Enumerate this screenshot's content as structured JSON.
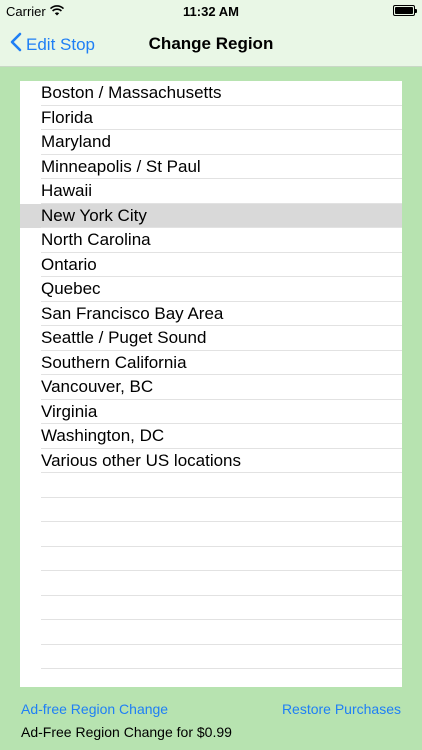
{
  "status_bar": {
    "carrier": "Carrier",
    "time": "11:32 AM"
  },
  "nav": {
    "back_label": "Edit Stop",
    "title": "Change Region"
  },
  "regions": [
    "Boston / Massachusetts",
    "Florida",
    "Maryland",
    "Minneapolis / St Paul",
    "Hawaii",
    "New York City",
    "North Carolina",
    "Ontario",
    "Quebec",
    "San Francisco Bay Area",
    "Seattle / Puget Sound",
    "Southern California",
    "Vancouver, BC",
    "Virginia",
    "Washington, DC",
    "Various other US locations"
  ],
  "selected_region": "New York City",
  "footer": {
    "ad_free_link": "Ad-free Region Change",
    "restore_link": "Restore Purchases",
    "price_text": "Ad-Free Region Change for $0.99"
  },
  "colors": {
    "accent": "#1f7ff5",
    "background": "#b7e3b0",
    "selected_row": "#d9d9d9"
  }
}
